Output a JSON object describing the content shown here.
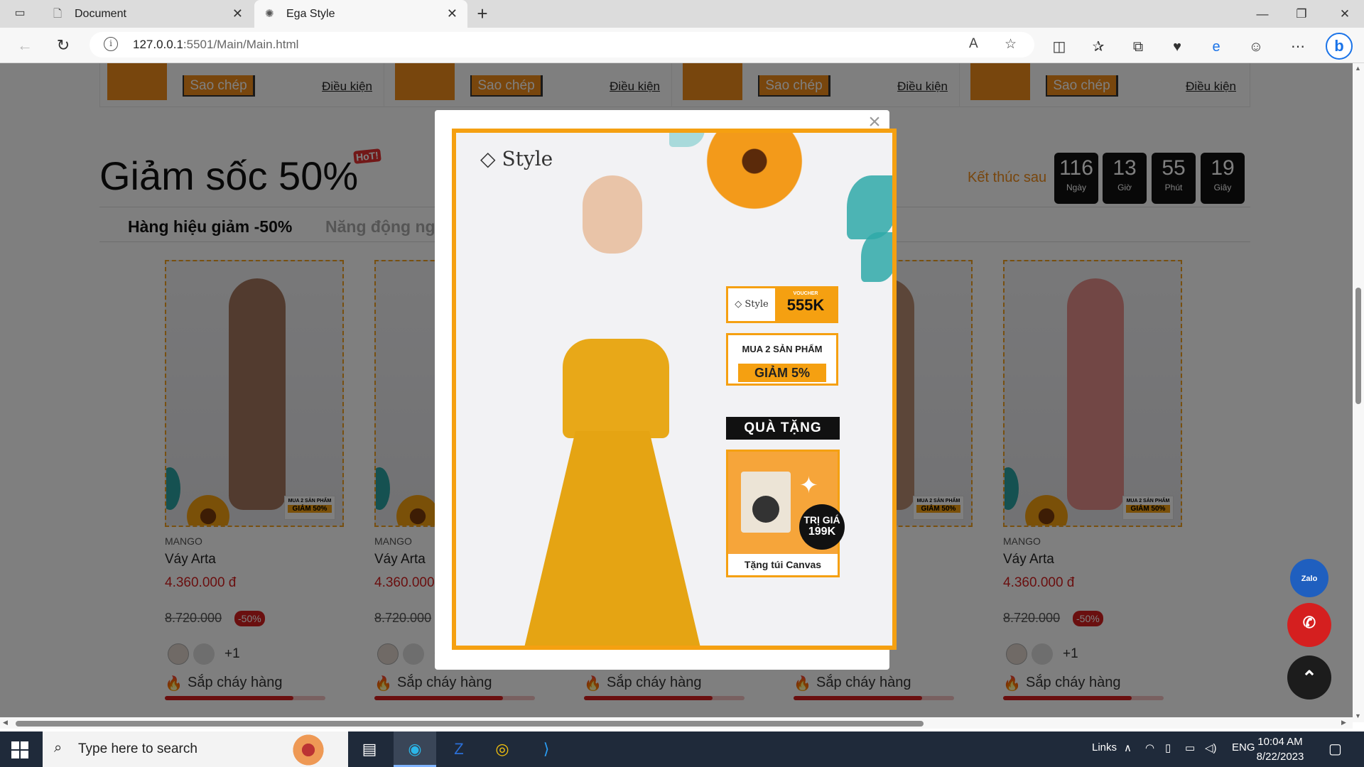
{
  "browser": {
    "tabs": [
      {
        "title": "Document"
      },
      {
        "title": "Ega Style"
      }
    ],
    "url_host": "127.0.0.1",
    "url_path": ":5501/Main/Main.html"
  },
  "coupons": [
    {
      "copy": "Sao chép",
      "terms": "Điều kiện"
    },
    {
      "copy": "Sao chép",
      "terms": "Điều kiện"
    },
    {
      "copy": "Sao chép",
      "terms": "Điều kiện"
    },
    {
      "copy": "Sao chép",
      "terms": "Điều kiện"
    }
  ],
  "flash_sale": {
    "title": "Giảm sốc 50%",
    "hot": "HoT!",
    "ends_label": "Kết thúc sau",
    "countdown": [
      {
        "value": "116",
        "unit": "Ngày"
      },
      {
        "value": "13",
        "unit": "Giờ"
      },
      {
        "value": "55",
        "unit": "Phút"
      },
      {
        "value": "19",
        "unit": "Giây"
      }
    ],
    "tabs": [
      "Hàng hiệu giảm -50%",
      "Năng động ng"
    ]
  },
  "products": [
    {
      "brand": "MANGO",
      "name": "Váy Arta",
      "price": "4.360.000 đ",
      "old_price": "8.720.000",
      "discount": "-50%",
      "more": "+1",
      "stock": "Sắp cháy hàng",
      "stock_level": 0.8,
      "badge_top": "MUA 2 SẢN PHẨM",
      "badge_bottom": "GIẢM 50%",
      "dress_color": "#a5765e"
    },
    {
      "brand": "MANGO",
      "name": "Váy Arta",
      "price": "4.360.000",
      "old_price": "8.720.000",
      "discount": "",
      "more": "+1",
      "stock": "Sắp cháy hàng",
      "stock_level": 0.8,
      "badge_top": "",
      "badge_bottom": "",
      "dress_color": "#b98d73"
    },
    {
      "brand": "",
      "name": "",
      "price": "",
      "old_price": "",
      "discount": "",
      "more": "",
      "stock": "Sắp cháy hàng",
      "stock_level": 0.8,
      "badge_top": "",
      "badge_bottom": "",
      "dress_color": "#b98d73"
    },
    {
      "brand": "",
      "name": "",
      "price": "",
      "old_price": "",
      "discount": "",
      "more": "",
      "stock": "Sắp cháy hàng",
      "stock_level": 0.8,
      "badge_top": "MUA 2 SẢN PHẨM",
      "badge_bottom": "GIẢM 50%",
      "dress_color": "#b98d73"
    },
    {
      "brand": "MANGO",
      "name": "Váy Arta",
      "price": "4.360.000 đ",
      "old_price": "8.720.000",
      "discount": "-50%",
      "more": "+1",
      "stock": "Sắp cháy hàng",
      "stock_level": 0.8,
      "badge_top": "MUA 2 SẢN PHẨM",
      "badge_bottom": "GIẢM 50%",
      "dress_color": "#e58f8a"
    }
  ],
  "popup": {
    "close": "×",
    "logo": "Style",
    "voucher_brand": "Style",
    "voucher_label": "VOUCHER",
    "voucher_value": "555K",
    "buy_text": "MUA 2 SẢN PHẨM",
    "buy_discount": "GIẢM 5%",
    "gift_header": "QUÀ TẶNG",
    "gift_price_label": "TRỊ GIÁ",
    "gift_price": "199K",
    "gift_footer": "Tặng túi Canvas"
  },
  "floating": {
    "zalo": "Zalo"
  },
  "taskbar": {
    "search_placeholder": "Type here to search",
    "links": "Links",
    "lang": "ENG",
    "time": "10:04 AM",
    "date": "8/22/2023"
  },
  "colors": {
    "accent": "#f08c1b",
    "sale_red": "#d51f1f"
  }
}
